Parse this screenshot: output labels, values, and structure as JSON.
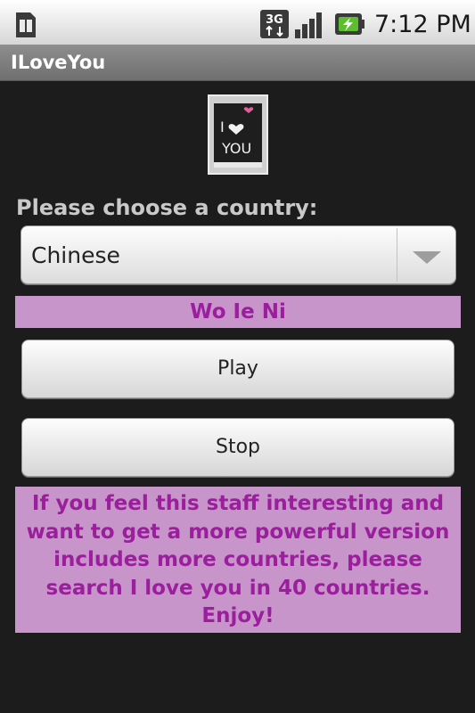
{
  "status_bar": {
    "time": "7:12 PM",
    "icons": [
      "sim-card-icon",
      "3g-data-icon",
      "signal-strength-icon",
      "battery-charging-icon"
    ]
  },
  "title_bar": {
    "title": "ILoveYou"
  },
  "image": {
    "icon": "i-love-you-chalkboard-icon",
    "caption_line1": "I",
    "caption_line2": "YOU"
  },
  "prompt": {
    "label": "Please choose a country:"
  },
  "spinner": {
    "selected": "Chinese"
  },
  "result": {
    "text": "Wo Ie Ni"
  },
  "buttons": {
    "play": "Play",
    "stop": "Stop"
  },
  "info": {
    "message": "If you feel this staff interesting and want to get a more powerful version includes more countries, please search I love you in 40 countries. Enjoy!"
  },
  "colors": {
    "accent_bg": "#c795c9",
    "accent_text": "#9b1e9d"
  }
}
